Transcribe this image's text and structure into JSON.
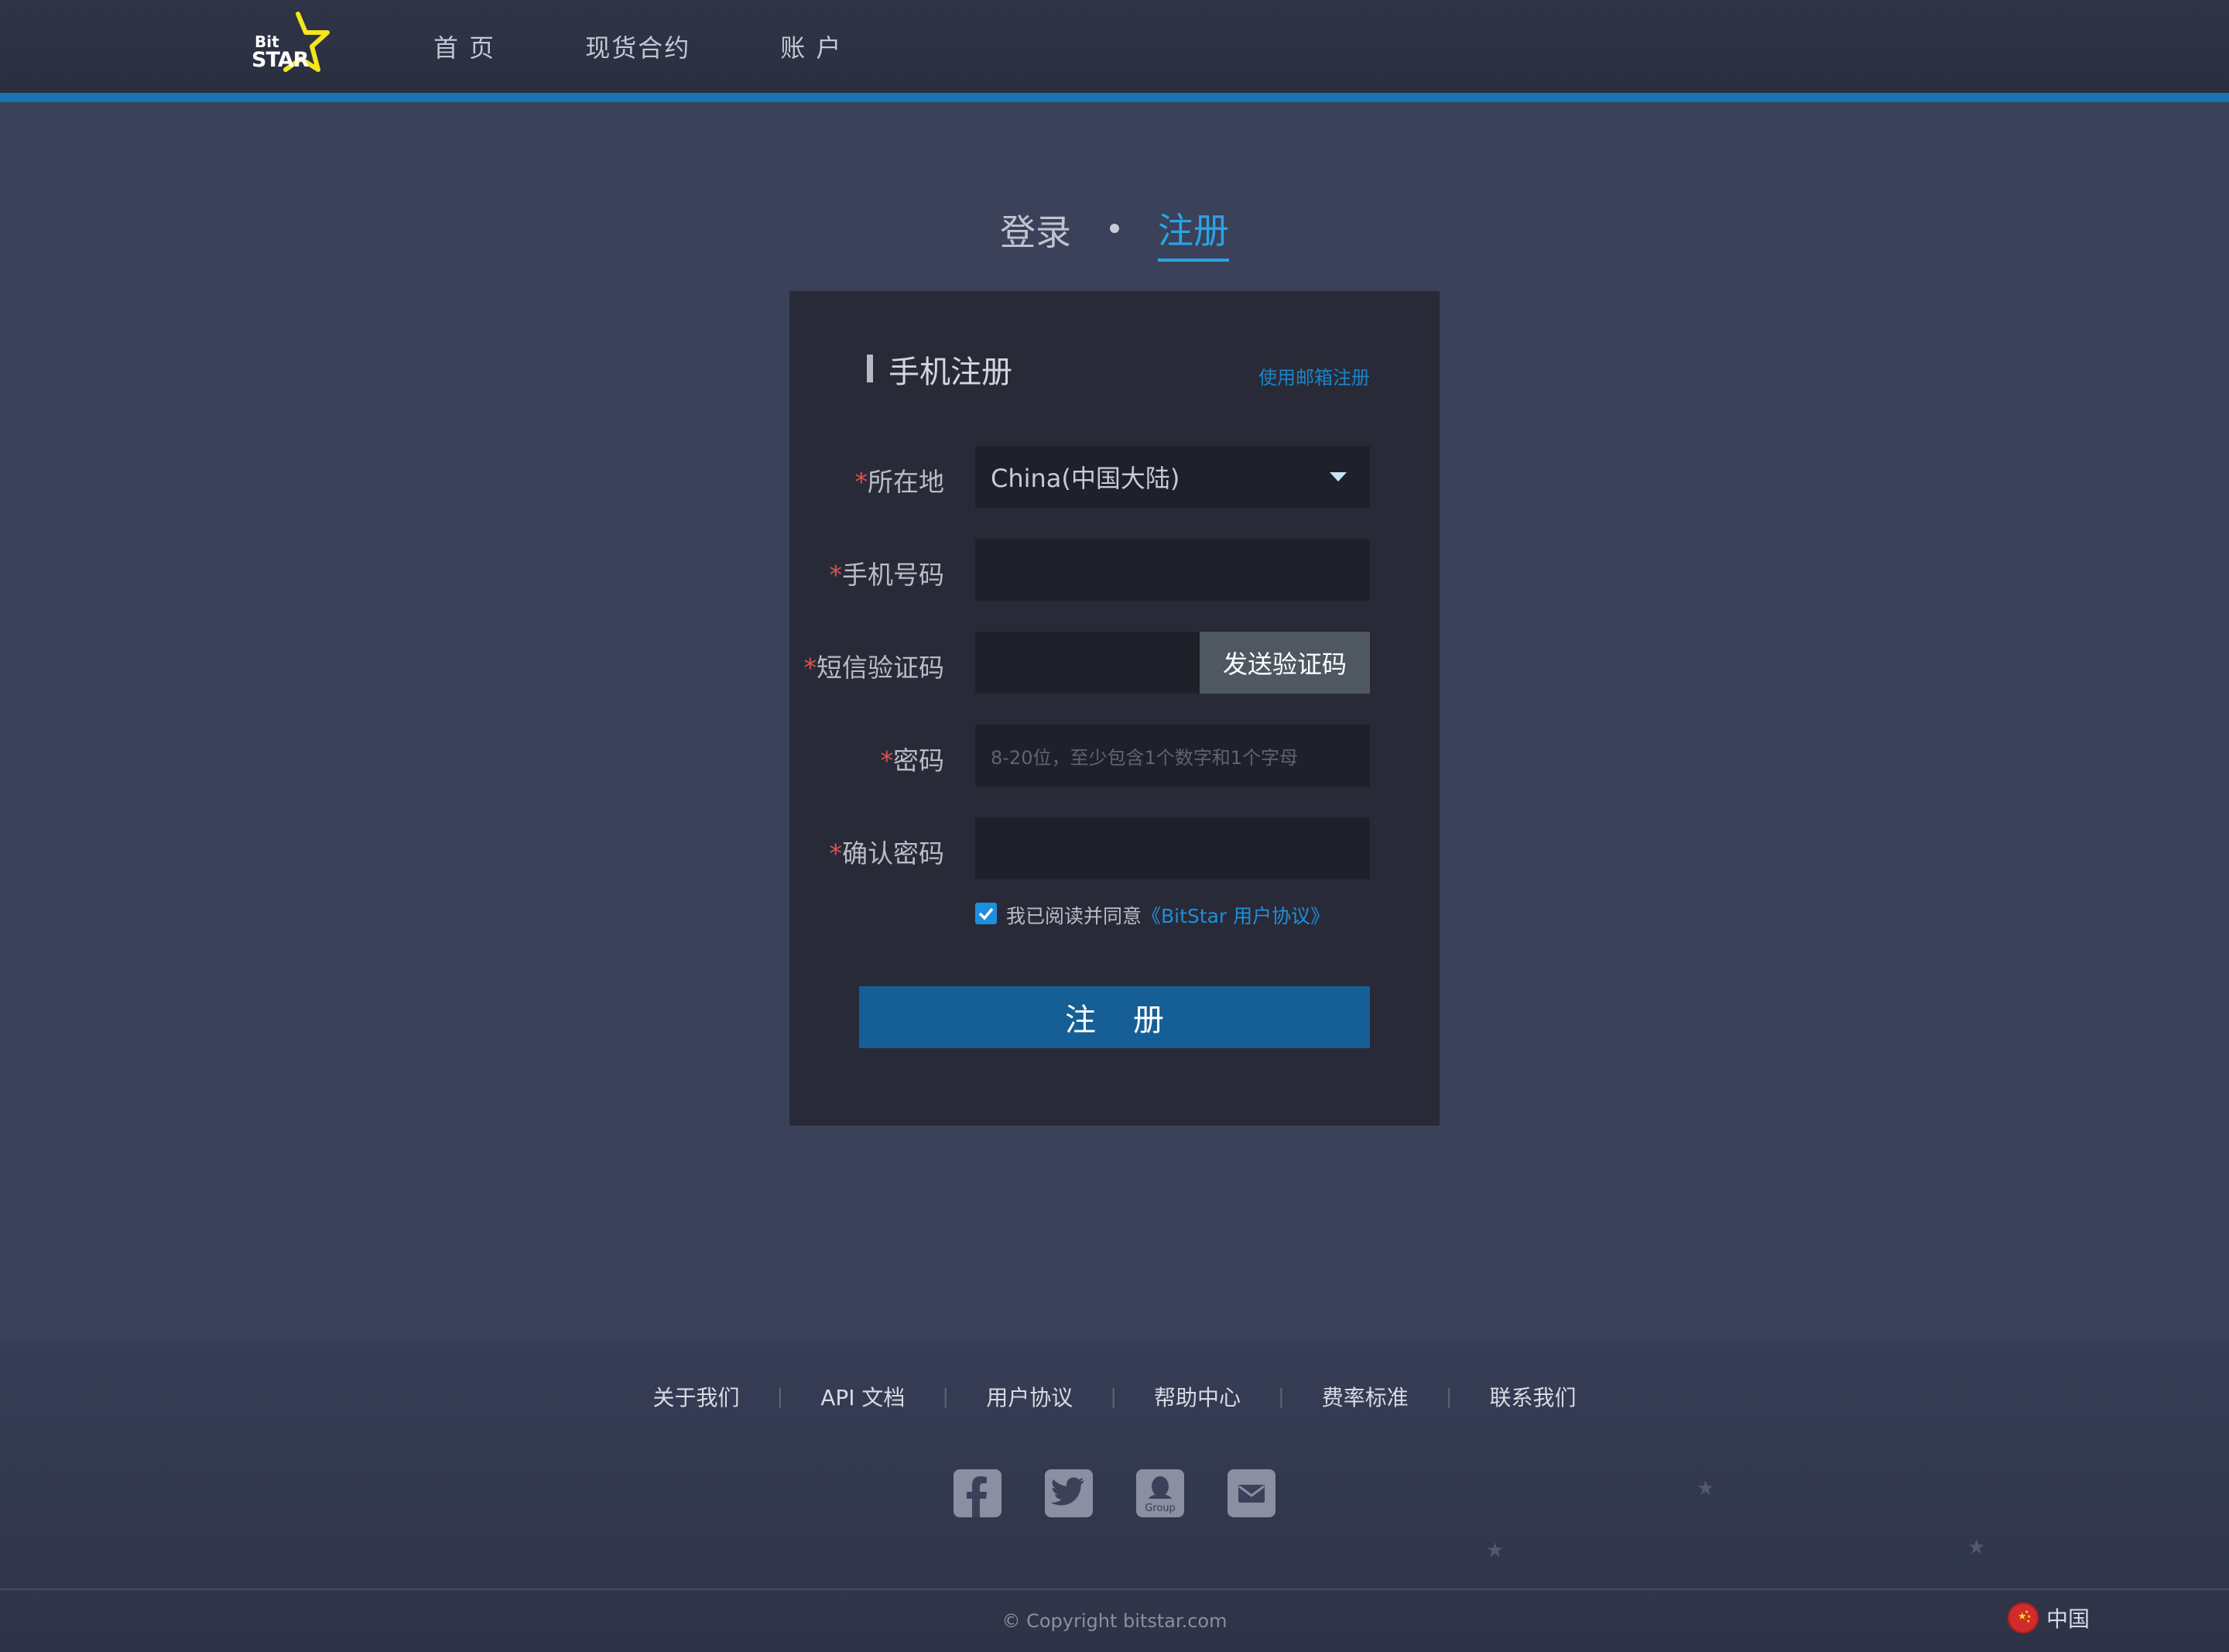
{
  "header": {
    "logo": {
      "small": "Bit",
      "large": "STAR",
      "accent_color": "#f5e61a"
    },
    "nav": [
      {
        "label": "首 页"
      },
      {
        "label": "现货合约"
      },
      {
        "label": "账 户"
      }
    ],
    "bar_color": "#1a73b5"
  },
  "tabs": [
    {
      "label": "登录",
      "active": false
    },
    {
      "label": "注册",
      "active": true
    }
  ],
  "form": {
    "title": "手机注册",
    "alt_link": "使用邮箱注册",
    "required_mark": "*",
    "fields": {
      "region": {
        "label": "所在地",
        "value": "China(中国大陆)"
      },
      "phone": {
        "label": "手机号码",
        "value": "",
        "placeholder": ""
      },
      "sms_code": {
        "label": "短信验证码",
        "value": "",
        "placeholder": ""
      },
      "password": {
        "label": "密码",
        "value": "",
        "placeholder": "8-20位，至少包含1个数字和1个字母"
      },
      "confirm_password": {
        "label": "确认密码",
        "value": "",
        "placeholder": ""
      }
    },
    "send_code_button": "发送验证码",
    "agree": {
      "checked": true,
      "text": "我已阅读并同意",
      "link": "《BitStar 用户协议》"
    },
    "submit_button": "注册",
    "accent_color": "#2aa3e6"
  },
  "footer": {
    "links": [
      "关于我们",
      "API 文档",
      "用户协议",
      "帮助中心",
      "费率标准",
      "联系我们"
    ],
    "separator": "|",
    "social": [
      {
        "icon": "facebook-icon"
      },
      {
        "icon": "twitter-icon"
      },
      {
        "icon": "qq-group-icon",
        "caption": "Group"
      },
      {
        "icon": "mail-icon"
      }
    ],
    "copyright": "© Copyright   bitstar.com",
    "language": "中国"
  }
}
